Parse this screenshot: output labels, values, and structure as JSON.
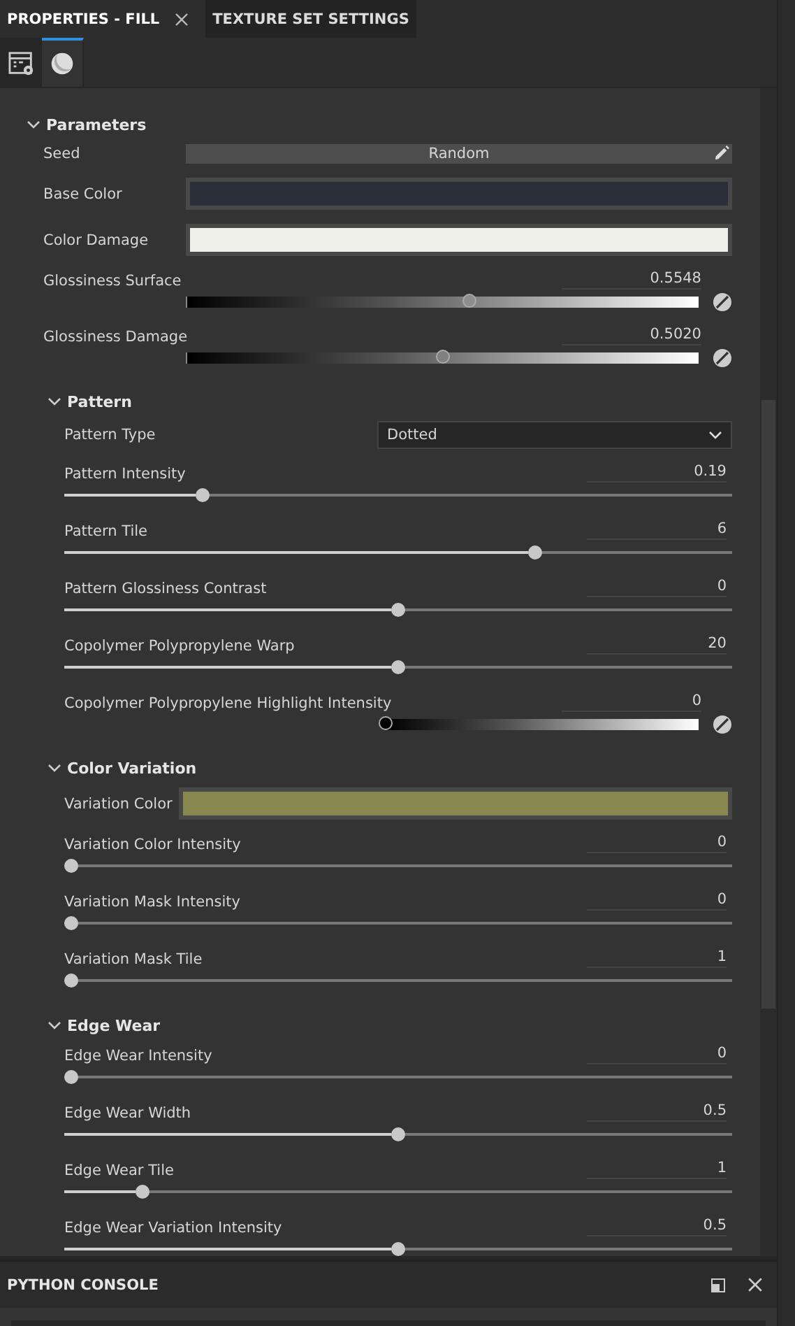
{
  "tabs": [
    {
      "label": "PROPERTIES - FILL",
      "selected": true,
      "closable": true
    },
    {
      "label": "TEXTURE SET SETTINGS",
      "selected": false,
      "closable": false
    }
  ],
  "tool_tabs": [
    {
      "kind": "settings",
      "selected": false
    },
    {
      "kind": "material",
      "selected": true
    }
  ],
  "sections": [
    {
      "title": "Parameters",
      "expanded": true,
      "rows": [
        {
          "kind": "button",
          "label": "Seed",
          "text": "Random"
        },
        {
          "kind": "color",
          "label": "Base Color",
          "color": "#2a2e38"
        },
        {
          "kind": "color",
          "label": "Color Damage",
          "color": "#efefea"
        },
        {
          "kind": "gradient",
          "label": "Glossiness Surface",
          "value": "0.5548",
          "level": 0.5548
        },
        {
          "kind": "gradient",
          "label": "Glossiness Damage",
          "value": "0.5020",
          "level": 0.502
        }
      ],
      "children": [
        {
          "title": "Pattern",
          "expanded": true,
          "rows": [
            {
              "kind": "dropdown",
              "label": "Pattern Type",
              "value": "Dotted"
            },
            {
              "kind": "slider",
              "label": "Pattern Intensity",
              "value": "0.19",
              "level": 0.2
            },
            {
              "kind": "slider",
              "label": "Pattern Tile",
              "value": "6",
              "level": 0.71
            },
            {
              "kind": "slider",
              "label": "Pattern Glossiness Contrast",
              "value": "0",
              "level": 0.5
            },
            {
              "kind": "slider",
              "label": "Copolymer Polypropylene Warp",
              "value": "20",
              "level": 0.5
            },
            {
              "kind": "gradient",
              "label": "Copolymer Polypropylene Highlight Intensity",
              "value": "0",
              "level": 0
            }
          ]
        },
        {
          "title": "Color Variation",
          "expanded": true,
          "rows": [
            {
              "kind": "color",
              "label": "Variation Color",
              "color": "#888850"
            },
            {
              "kind": "slider",
              "label": "Variation Color Intensity",
              "value": "0",
              "level": 0
            },
            {
              "kind": "slider",
              "label": "Variation Mask Intensity",
              "value": "0",
              "level": 0
            },
            {
              "kind": "slider",
              "label": "Variation Mask Tile",
              "value": "1",
              "level": 0
            }
          ]
        },
        {
          "title": "Edge Wear",
          "expanded": true,
          "rows": [
            {
              "kind": "slider",
              "label": "Edge Wear Intensity",
              "value": "0",
              "level": 0
            },
            {
              "kind": "slider",
              "label": "Edge Wear Width",
              "value": "0.5",
              "level": 0.5
            },
            {
              "kind": "slider",
              "label": "Edge Wear Tile",
              "value": "1",
              "level": 0.11
            },
            {
              "kind": "slider",
              "label": "Edge Wear Variation Intensity",
              "value": "0.5",
              "level": 0.5
            }
          ]
        }
      ]
    }
  ],
  "console": {
    "title": "PYTHON CONSOLE"
  }
}
